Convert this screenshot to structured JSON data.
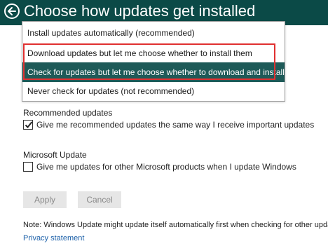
{
  "header": {
    "title": "Choose how updates get installed",
    "back_icon": "back-arrow-icon"
  },
  "dropdown": {
    "options": [
      {
        "label": "Install updates automatically (recommended)",
        "selected": false
      },
      {
        "label": "Download updates but let me choose whether to install them",
        "selected": false
      },
      {
        "label": "Check for updates but let me choose whether to download and install them",
        "selected": true
      },
      {
        "label": "Never check for updates (not recommended)",
        "selected": false
      }
    ]
  },
  "recommended": {
    "heading": "Recommended updates",
    "checkbox_label": "Give me recommended updates the same way I receive important updates",
    "checked": true
  },
  "microsoft_update": {
    "heading": "Microsoft Update",
    "checkbox_label": "Give me updates for other Microsoft products when I update Windows",
    "checked": false
  },
  "buttons": {
    "apply": "Apply",
    "cancel": "Cancel"
  },
  "note": "Note: Windows Update might update itself automatically first when checking for other updates.",
  "privacy_link": "Privacy statement",
  "colors": {
    "header_bg": "#0b4a47",
    "selected_bg": "#1e5a58",
    "highlight": "#e03030",
    "link": "#1a5fa8"
  }
}
